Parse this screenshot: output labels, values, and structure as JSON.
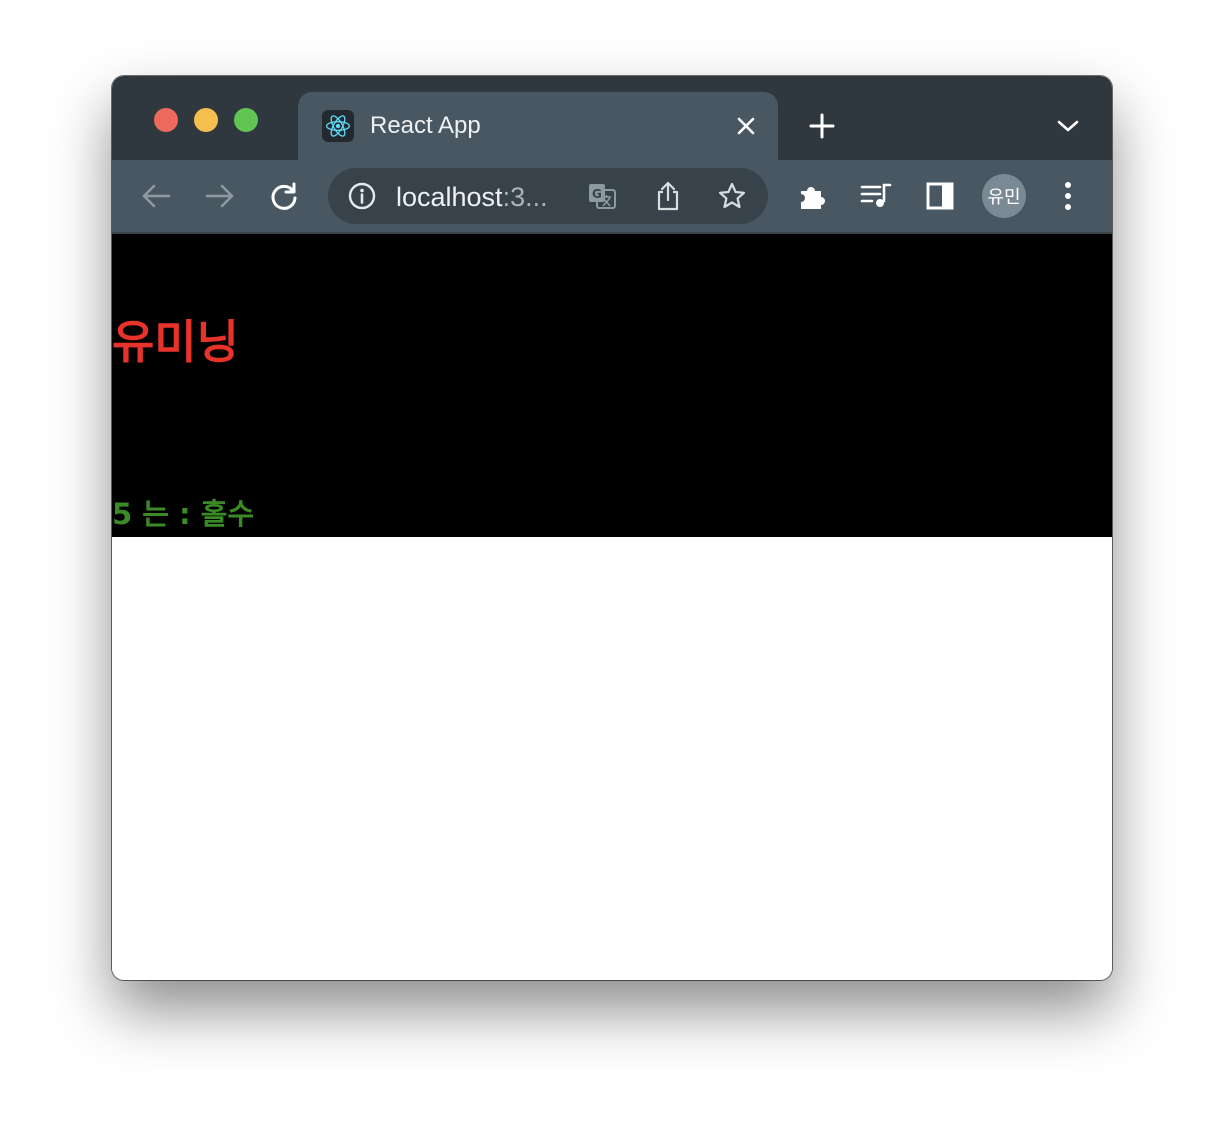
{
  "browser": {
    "tab": {
      "title": "React App",
      "favicon": "react-logo-icon"
    },
    "address_bar": {
      "url_host": "localhost",
      "url_rest": ":3..."
    },
    "profile": {
      "initials": "유민"
    },
    "colors": {
      "tabstrip": "#2f383f",
      "toolbar": "#485761",
      "omnibox": "#37424a",
      "traffic_red": "#ee6a5e",
      "traffic_yellow": "#f5bf4f",
      "traffic_green": "#61c554"
    }
  },
  "page": {
    "title": "유미닝",
    "result_text": "5 는 : 홀수",
    "colors": {
      "header_bg": "#000000",
      "title": "#e8332a",
      "result": "#3a8a26"
    }
  }
}
